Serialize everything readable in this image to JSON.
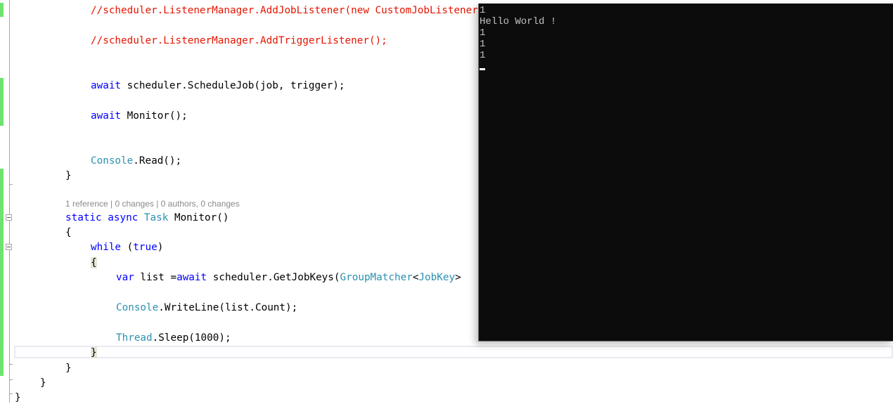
{
  "editor": {
    "code_lens": "1 reference | 0 changes | 0 authors, 0 changes",
    "lines": {
      "l1_comment": "//scheduler.ListenerManager.AddJobListener(new CustomJobListener",
      "l2_comment": "//scheduler.ListenerManager.AddTriggerListener();",
      "l3_kw": "await",
      "l3_rest": " scheduler.ScheduleJob(job, trigger);",
      "l4_kw": "await",
      "l4_rest": " Monitor();",
      "l5_type": "Console",
      "l5_rest": ".Read();",
      "l6": "}",
      "l7_kw1": "static",
      "l7_kw2": "async",
      "l7_type": "Task",
      "l7_rest": " Monitor()",
      "l8": "{",
      "l9_kw": "while",
      "l9_rest1": " (",
      "l9_kw2": "true",
      "l9_rest2": ")",
      "l10": "{",
      "l11_kw": "var",
      "l11_mid": " list =",
      "l11_kw2": "await",
      "l11_mid2": " scheduler.GetJobKeys(",
      "l11_type": "GroupMatcher",
      "l11_lt": "<",
      "l11_type2": "JobKey",
      "l11_gt": ">",
      "l12_type": "Console",
      "l12_rest": ".WriteLine(list.Count);",
      "l13_type": "Thread",
      "l13_rest": ".Sleep(1000);",
      "l14": "}",
      "l15": "}",
      "l16": "}",
      "l17": "}"
    }
  },
  "console": {
    "output": [
      "1",
      "Hello World !",
      "1",
      "1",
      "1"
    ]
  },
  "colors": {
    "keyword": "#0000ff",
    "type": "#2b91af",
    "comment": "#e51400",
    "console_bg": "#0c0c0c",
    "console_fg": "#c0c0c0",
    "change_bar": "#6ee36e"
  }
}
